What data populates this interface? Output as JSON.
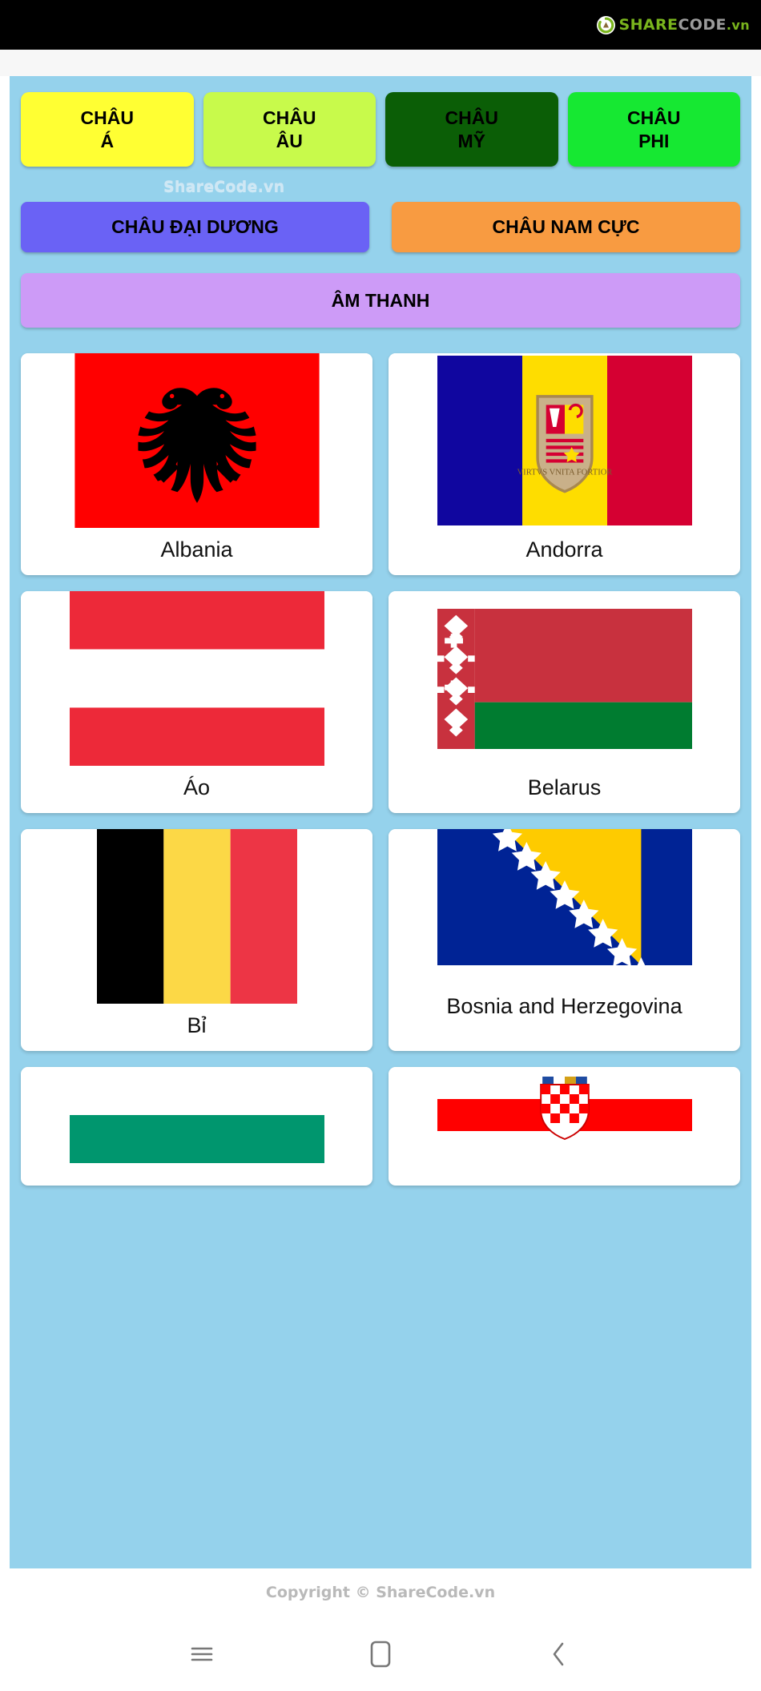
{
  "watermark": {
    "logo_share": "SHARE",
    "logo_code": "CODE",
    "logo_tld": ".vn",
    "mid_text": "ShareCode.vn",
    "copyright": "Copyright © ShareCode.vn"
  },
  "continents": [
    {
      "label_line1": "CHÂU",
      "label_line2": "Á",
      "color": "#ffff33",
      "name": "chau-a"
    },
    {
      "label_line1": "CHÂU",
      "label_line2": "ÂU",
      "color": "#c8fa4b",
      "name": "chau-au"
    },
    {
      "label_line1": "CHÂU",
      "label_line2": "MỸ",
      "color": "#0b5e06",
      "name": "chau-my"
    },
    {
      "label_line1": "CHÂU",
      "label_line2": "PHI",
      "color": "#16e832",
      "name": "chau-phi"
    }
  ],
  "wide_buttons": [
    {
      "label": "CHÂU ĐẠI DƯƠNG",
      "color": "#6a62f5",
      "name": "chau-dai-duong"
    },
    {
      "label": "CHÂU NAM CỰC",
      "color": "#f89b41",
      "name": "chau-nam-cuc"
    }
  ],
  "sound_button": {
    "label": "ÂM THANH",
    "color": "#cd9bf7"
  },
  "flags": [
    {
      "name": "Albania",
      "flag": "albania"
    },
    {
      "name": "Andorra",
      "flag": "andorra"
    },
    {
      "name": "Áo",
      "flag": "austria"
    },
    {
      "name": "Belarus",
      "flag": "belarus"
    },
    {
      "name": "Bỉ",
      "flag": "belgium"
    },
    {
      "name": "Bosnia and Herzegovina",
      "flag": "bosnia"
    },
    {
      "name": "",
      "flag": "bulgaria"
    },
    {
      "name": "",
      "flag": "croatia"
    }
  ],
  "navbar": {
    "recents": "menu-icon",
    "home": "home-icon",
    "back": "back-icon"
  },
  "colors": {
    "app_background": "#95d2ec",
    "card_background": "#ffffff",
    "top_bar": "#000000"
  }
}
